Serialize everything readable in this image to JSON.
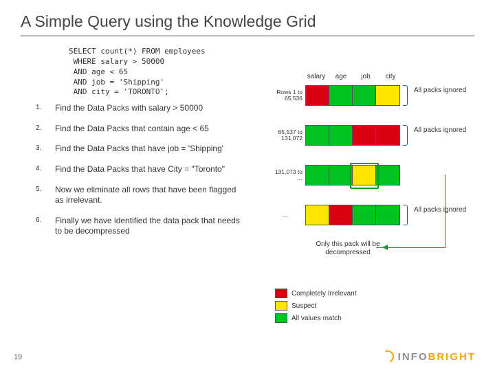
{
  "title": "A Simple Query using the Knowledge Grid",
  "query": "SELECT count(*) FROM employees\n WHERE salary > 50000\n AND age < 65\n AND job = 'Shipping'\n AND city = 'TORONTO';",
  "steps": [
    "Find the Data Packs with salary > 50000",
    "Find the Data Packs that contain age < 65",
    "Find the Data Packs that have job = 'Shipping'",
    "Find the Data Packs that have City = \"Toronto\"",
    "Now we eliminate all rows that have been flagged as irrelevant.",
    "Finally we have identified the data pack that needs to be decompressed"
  ],
  "columns": [
    "salary",
    "age",
    "job",
    "city"
  ],
  "rows": [
    {
      "label": "Rows 1 to 65,536",
      "cells": [
        "r",
        "g",
        "g",
        "y"
      ]
    },
    {
      "label": "65,537 to 131,072",
      "cells": [
        "g",
        "g",
        "r",
        "r"
      ]
    },
    {
      "label": "131,073 to …",
      "cells": [
        "g",
        "g",
        "y",
        "g"
      ]
    },
    {
      "label": "…",
      "cells": [
        "y",
        "r",
        "g",
        "g"
      ]
    }
  ],
  "ignored_label": "All packs ignored",
  "decomp_label": "Only this pack will be decompressed",
  "legend": {
    "r": "Completely Irrelevant",
    "y": "Suspect",
    "g": "All values match"
  },
  "page_number": "19",
  "logo": {
    "a": "INFO",
    "b": "BRIGHT"
  },
  "chart_data": {
    "type": "table",
    "title": "Knowledge Grid pack status",
    "columns": [
      "salary",
      "age",
      "job",
      "city"
    ],
    "row_labels": [
      "Rows 1 to 65,536",
      "65,537 to 131,072",
      "131,073 to …",
      "…"
    ],
    "cells": [
      [
        "Completely Irrelevant",
        "All values match",
        "All values match",
        "Suspect"
      ],
      [
        "All values match",
        "All values match",
        "Completely Irrelevant",
        "Completely Irrelevant"
      ],
      [
        "All values match",
        "All values match",
        "Suspect",
        "All values match"
      ],
      [
        "Suspect",
        "Completely Irrelevant",
        "All values match",
        "All values match"
      ]
    ],
    "row_outcome": [
      "All packs ignored",
      "All packs ignored",
      null,
      "All packs ignored"
    ],
    "highlighted_cell": {
      "row": 2,
      "column": "job",
      "note": "Only this pack will be decompressed"
    },
    "legend": {
      "Completely Irrelevant": "#d90012",
      "Suspect": "#ffe600",
      "All values match": "#00c221"
    }
  }
}
